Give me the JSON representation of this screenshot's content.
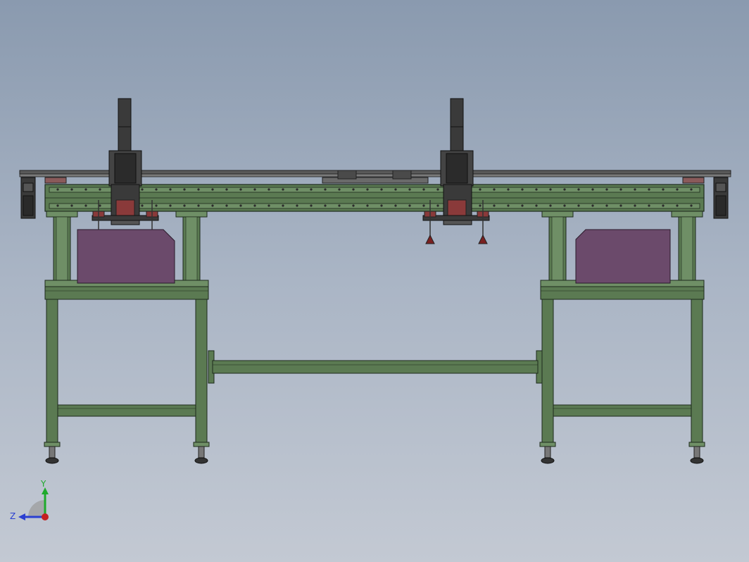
{
  "scene": {
    "title": "",
    "colors": {
      "frame": "#5b7a52",
      "frame_dark": "#2f4430",
      "frame_light": "#6f8f66",
      "panel": "#6b4a6b",
      "motor": "#3a3a3a",
      "bracket": "#8a3a3a",
      "rail": "#333333"
    }
  },
  "triad": {
    "y_label": "Y",
    "z_label": "Z",
    "y_color": "#1faa2c",
    "z_color": "#2a3fd1",
    "origin_color": "#c42020"
  }
}
